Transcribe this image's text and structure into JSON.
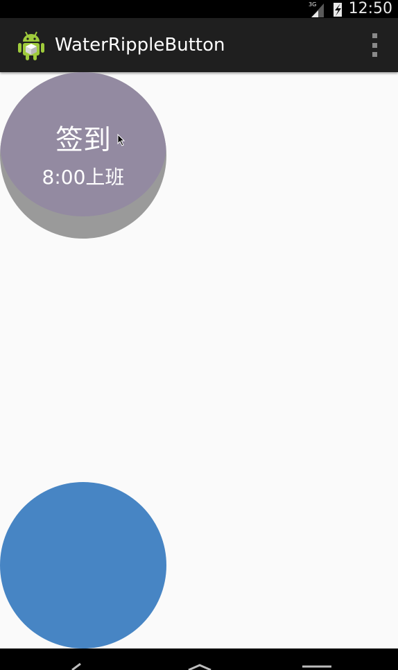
{
  "status_bar": {
    "time": "12:50",
    "network_label": "3G"
  },
  "action_bar": {
    "app_icon": "android-robot-icon",
    "title": "WaterRippleButton",
    "overflow_icon": "overflow-menu-icon"
  },
  "main": {
    "checkin_button": {
      "label": "签到",
      "sub_label": "8:00上班",
      "color": "#938aa1",
      "shadow_color": "#9a9a9a"
    },
    "second_button": {
      "color": "#4785c4"
    }
  },
  "nav_bar": {
    "back_icon": "back-icon",
    "home_icon": "home-icon",
    "recents_icon": "recents-icon"
  }
}
